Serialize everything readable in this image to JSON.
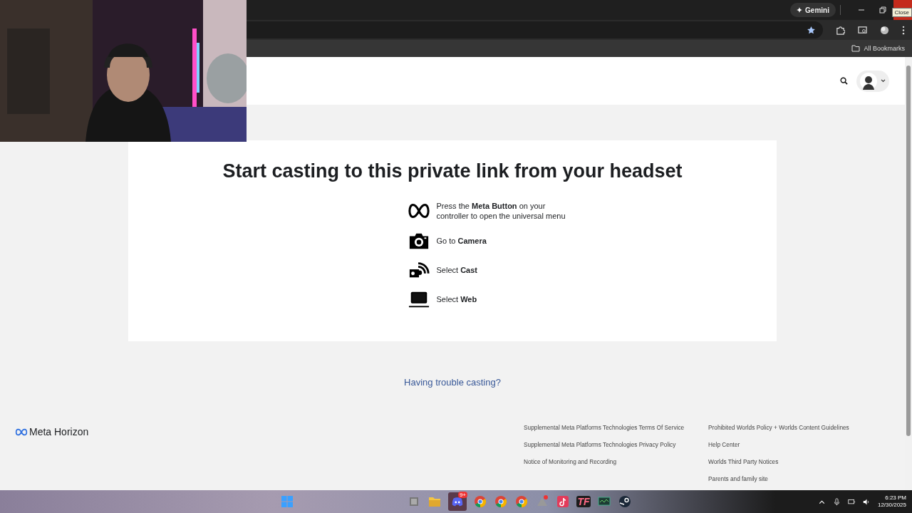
{
  "browser": {
    "gemini_button": "Gemini",
    "tooltip": "Close",
    "bookmarks_label": "All Bookmarks"
  },
  "card": {
    "title": "Start casting to this private link from your headset",
    "steps": [
      {
        "kind": "meta",
        "text": "Press the **Meta Button** on your controller to open the universal menu"
      },
      {
        "kind": "camera",
        "text": "Go to **Camera**"
      },
      {
        "kind": "cast",
        "text": "Select **Cast**"
      },
      {
        "kind": "web",
        "text": "Select **Web**"
      }
    ]
  },
  "trouble_link": "Having trouble casting?",
  "footer": {
    "logo": "Meta Horizon",
    "columns": [
      [
        "Supplemental Meta Platforms Technologies Terms Of Service",
        "Supplemental Meta Platforms Technologies Privacy Policy",
        "Notice of Monitoring and Recording"
      ],
      [
        "Prohibited Worlds Policy + Worlds Content Guidelines",
        "Help Center",
        "Worlds Third Party Notices",
        "Parents and family site"
      ]
    ]
  },
  "taskbar": {
    "apps": [
      {
        "kind": "files"
      },
      {
        "kind": "folder"
      },
      {
        "kind": "discord",
        "badge": "9+"
      },
      {
        "kind": "chrome"
      },
      {
        "kind": "chrome"
      },
      {
        "kind": "chrome"
      },
      {
        "kind": "triangle"
      },
      {
        "kind": "tiktok"
      },
      {
        "kind": "tf",
        "label": "TF"
      },
      {
        "kind": "monitor"
      },
      {
        "kind": "steam"
      }
    ],
    "time": "6:23 PM",
    "date": "12/30/2025"
  }
}
